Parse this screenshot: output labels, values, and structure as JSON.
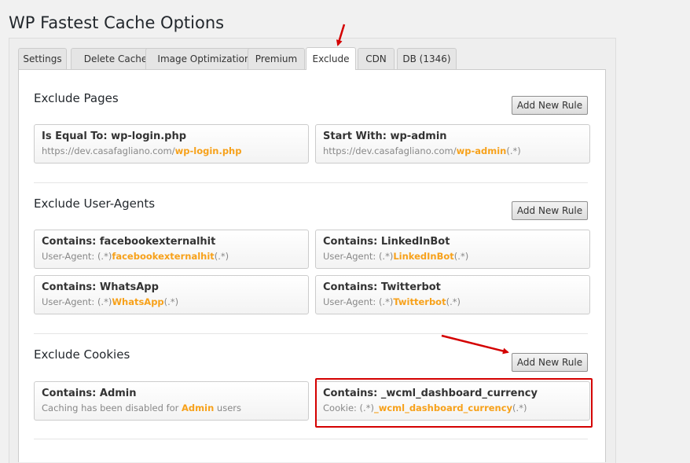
{
  "page": {
    "title": "WP Fastest Cache Options"
  },
  "tabs": [
    {
      "label": "Settings"
    },
    {
      "label": "Delete Cache"
    },
    {
      "label": "Image Optimization"
    },
    {
      "label": "Premium"
    },
    {
      "label": "Exclude"
    },
    {
      "label": "CDN"
    },
    {
      "label": "DB (1346)"
    }
  ],
  "active_tab": "Exclude",
  "sections": {
    "pages": {
      "title": "Exclude Pages",
      "button": "Add New Rule",
      "rules": [
        {
          "title": "Is Equal To: wp-login.php",
          "prefix": "https://dev.casafagliano.com/",
          "highlight": "wp-login.php",
          "suffix": ""
        },
        {
          "title": "Start With: wp-admin",
          "prefix": "https://dev.casafagliano.com/",
          "highlight": "wp-admin",
          "suffix": "(.*)"
        }
      ]
    },
    "useragents": {
      "title": "Exclude User-Agents",
      "button": "Add New Rule",
      "rules": [
        {
          "title": "Contains: facebookexternalhit",
          "prefix": "User-Agent: (.*)",
          "highlight": "facebookexternalhit",
          "suffix": "(.*)"
        },
        {
          "title": "Contains: LinkedInBot",
          "prefix": "User-Agent: (.*)",
          "highlight": "LinkedInBot",
          "suffix": "(.*)"
        },
        {
          "title": "Contains: WhatsApp",
          "prefix": "User-Agent: (.*)",
          "highlight": "WhatsApp",
          "suffix": "(.*)"
        },
        {
          "title": "Contains: Twitterbot",
          "prefix": "User-Agent: (.*)",
          "highlight": "Twitterbot",
          "suffix": "(.*)"
        }
      ]
    },
    "cookies": {
      "title": "Exclude Cookies",
      "button": "Add New Rule",
      "rules": [
        {
          "title": "Contains: Admin",
          "prefix": "Caching has been disabled for ",
          "highlight": "Admin",
          "suffix": " users"
        },
        {
          "title": "Contains: _wcml_dashboard_currency",
          "prefix": "Cookie: (.*)",
          "highlight": "_wcml_dashboard_currency",
          "suffix": "(.*)"
        }
      ]
    }
  },
  "colors": {
    "highlight_text": "#f7a11a",
    "annotation_red": "#d40000"
  }
}
